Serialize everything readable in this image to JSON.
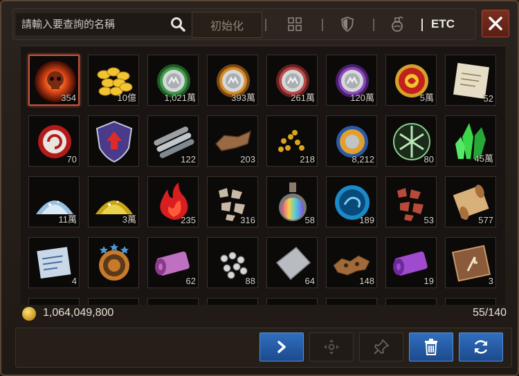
{
  "search": {
    "placeholder": "請輸入要查詢的名稱",
    "reset_label": "初始化"
  },
  "tabs": {
    "etc_label": "ETC"
  },
  "items": [
    {
      "icon": "flaming-skull-orb-icon",
      "count": "354"
    },
    {
      "icon": "gold-coins-icon",
      "count": "10億"
    },
    {
      "icon": "green-silver-medal-icon",
      "count": "1,021萬"
    },
    {
      "icon": "orange-silver-medal-icon",
      "count": "393萬"
    },
    {
      "icon": "red-silver-medal-icon",
      "count": "261萬"
    },
    {
      "icon": "purple-silver-medal-icon",
      "count": "120萬"
    },
    {
      "icon": "red-gold-emblem-icon",
      "count": "5萬"
    },
    {
      "icon": "parchment-letter-icon",
      "count": "52"
    },
    {
      "icon": "red-swirl-coin-icon",
      "count": "70"
    },
    {
      "icon": "upgrade-shield-icon",
      "count": ""
    },
    {
      "icon": "iron-bars-icon",
      "count": "122"
    },
    {
      "icon": "leather-scrap-icon",
      "count": "203"
    },
    {
      "icon": "gold-nuggets-icon",
      "count": "218"
    },
    {
      "icon": "blue-gold-coin-icon",
      "count": "8,212"
    },
    {
      "icon": "green-crest-icon",
      "count": "80"
    },
    {
      "icon": "green-crystal-icon",
      "count": "45萬"
    },
    {
      "icon": "white-crystal-pile-icon",
      "count": "11萬"
    },
    {
      "icon": "gold-powder-pile-icon",
      "count": "3萬"
    },
    {
      "icon": "red-flame-icon",
      "count": "235"
    },
    {
      "icon": "stone-shards-icon",
      "count": "316"
    },
    {
      "icon": "rainbow-potion-icon",
      "count": "58"
    },
    {
      "icon": "blue-dragon-coin-icon",
      "count": "189"
    },
    {
      "icon": "red-ore-shards-icon",
      "count": "53"
    },
    {
      "icon": "ancient-scroll-icon",
      "count": "577"
    },
    {
      "icon": "blue-letter-icon",
      "count": "4"
    },
    {
      "icon": "bronze-star-medal-icon",
      "count": ""
    },
    {
      "icon": "pink-cloth-roll-icon",
      "count": "62"
    },
    {
      "icon": "silver-ore-icon",
      "count": "88"
    },
    {
      "icon": "grey-cloth-icon",
      "count": "64"
    },
    {
      "icon": "animal-pelt-icon",
      "count": "148"
    },
    {
      "icon": "purple-cloth-roll-icon",
      "count": "19"
    },
    {
      "icon": "rune-tablet-icon",
      "count": "3"
    }
  ],
  "footer": {
    "gold": "1,064,049,800",
    "slots": "55/140"
  }
}
